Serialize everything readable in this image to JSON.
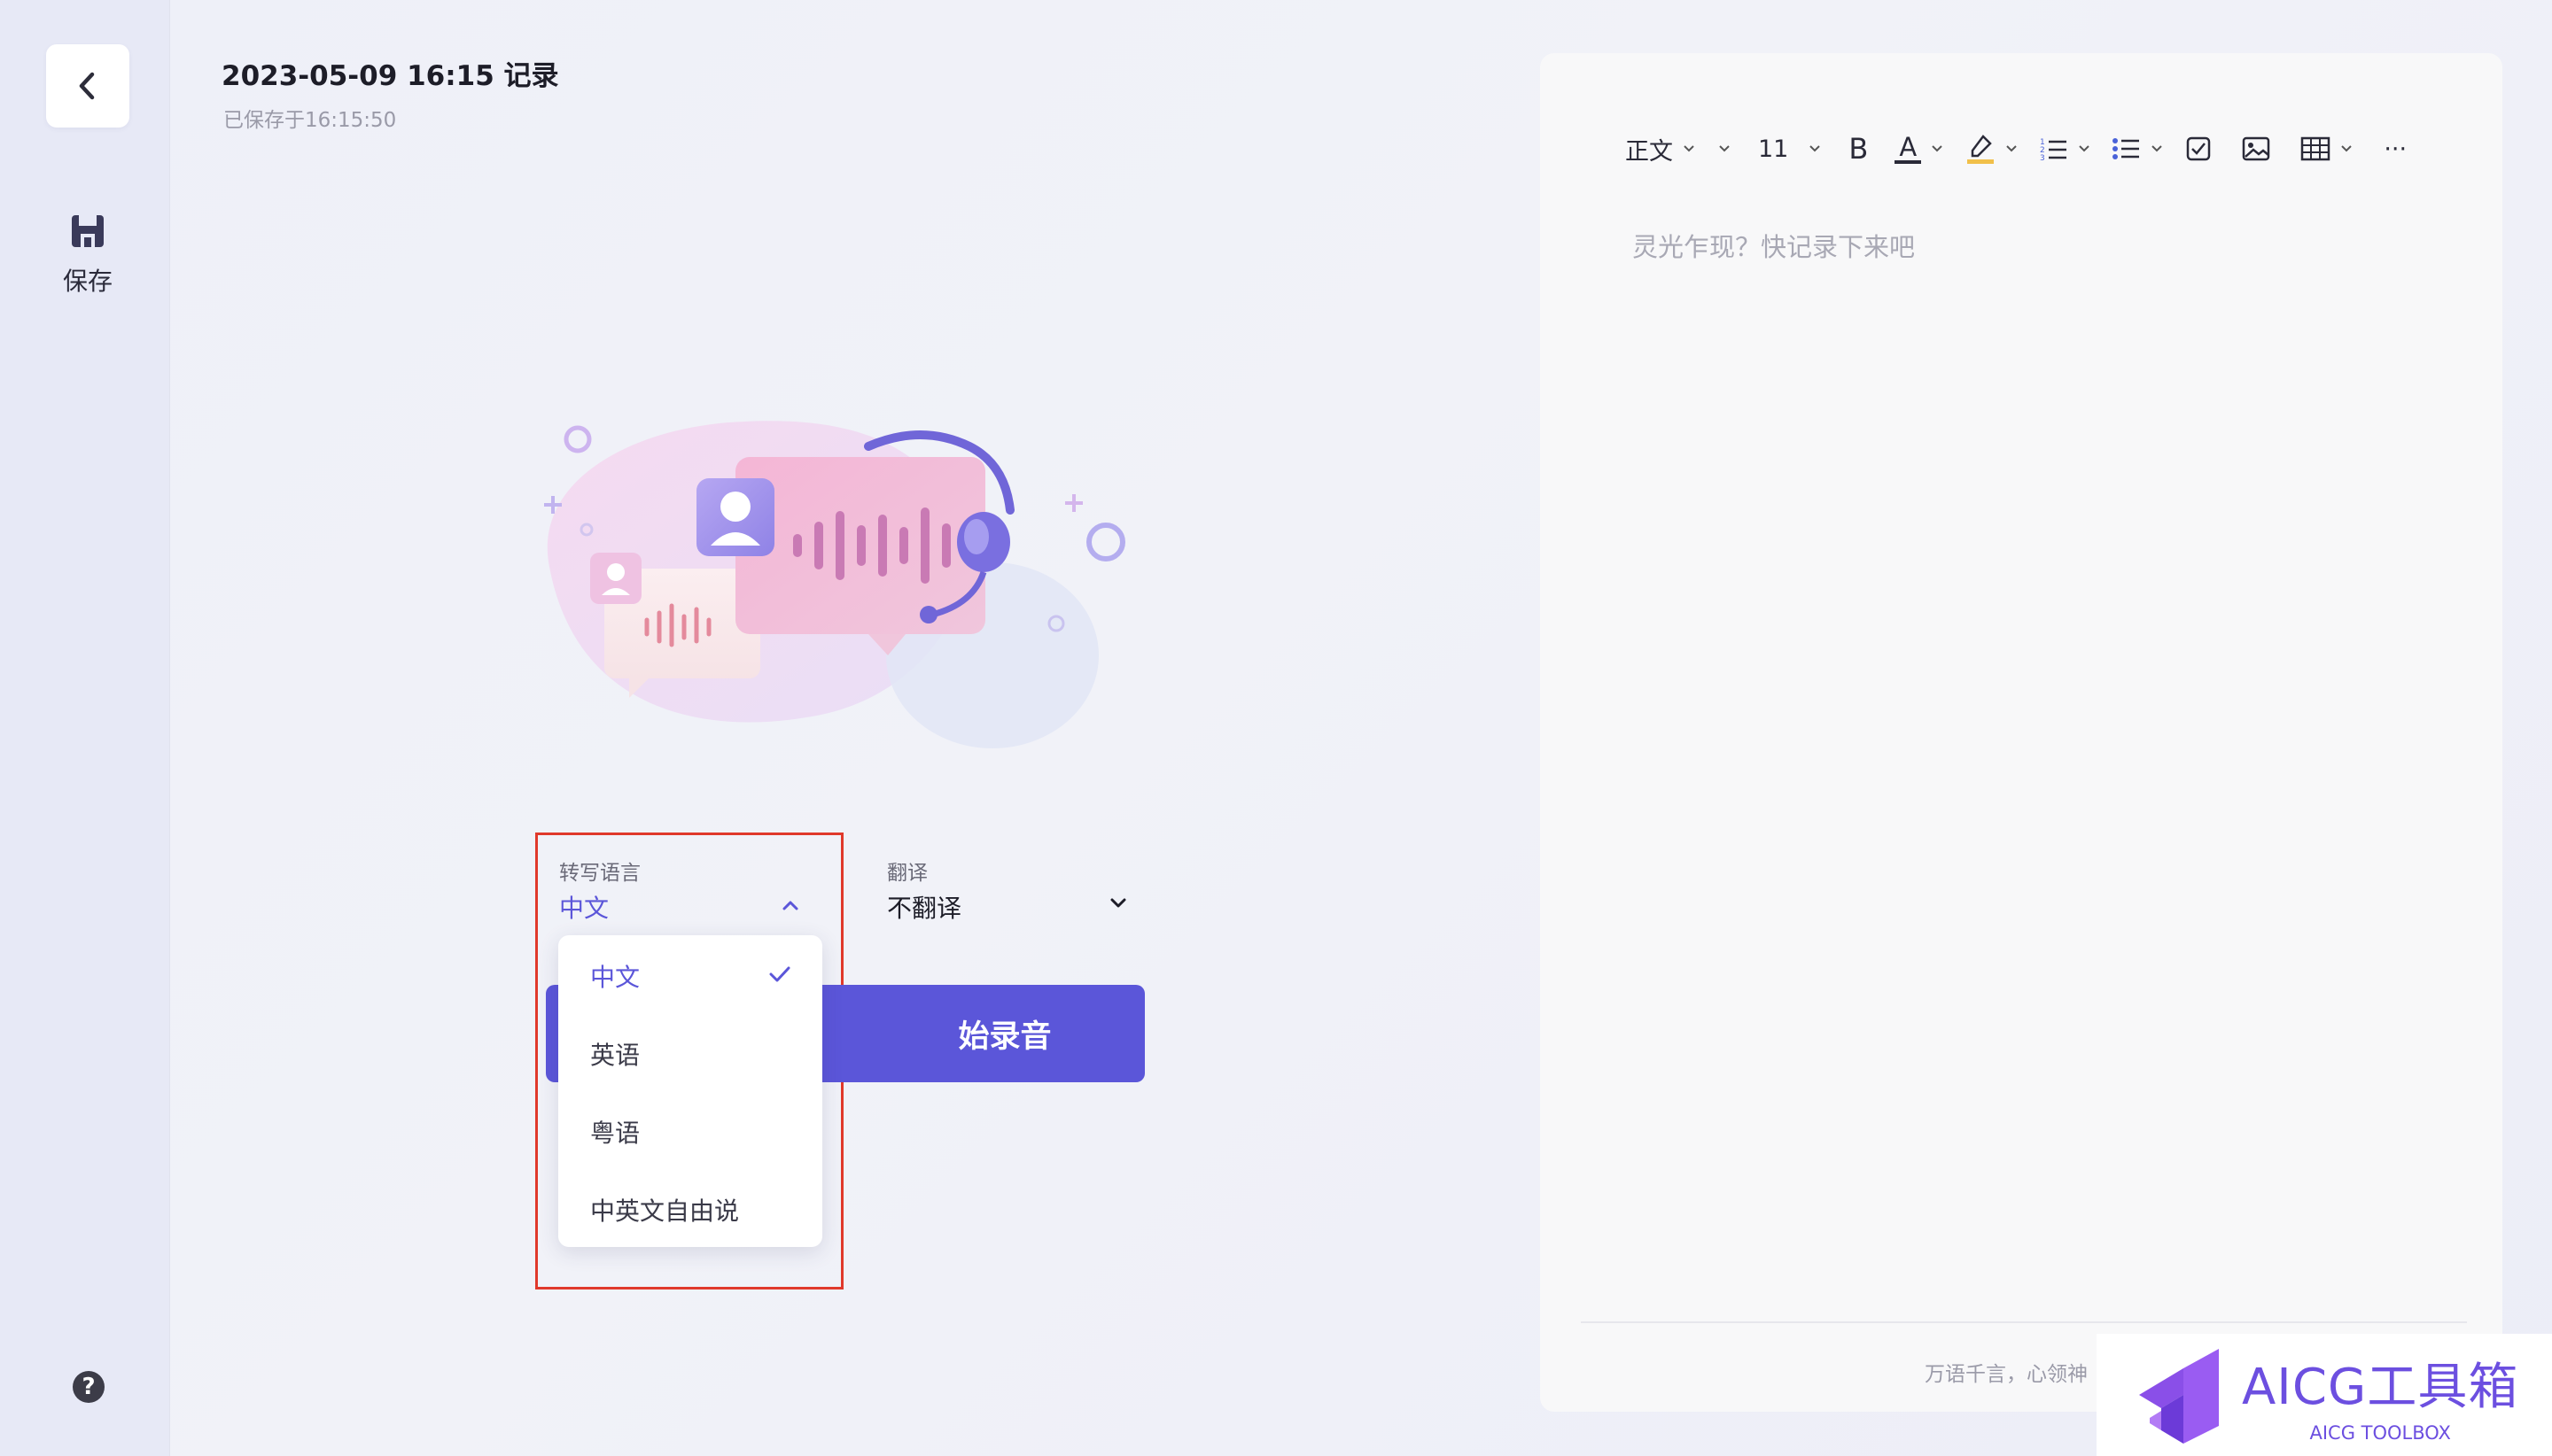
{
  "header": {
    "title": "2023-05-09 16:15 记录",
    "saved_status": "已保存于16:15:50"
  },
  "sidebar": {
    "save_label": "保存",
    "icons": [
      "back-arrow-icon",
      "save-disk-icon",
      "help-icon"
    ]
  },
  "transcribe": {
    "language_label": "转写语言",
    "language_value": "中文",
    "translate_label": "翻译",
    "translate_value": "不翻译",
    "record_button": "开始录音",
    "record_button_visible": "始录音"
  },
  "dropdown": {
    "options": [
      {
        "label": "中文",
        "selected": true
      },
      {
        "label": "英语",
        "selected": false
      },
      {
        "label": "粤语",
        "selected": false
      },
      {
        "label": "中英文自由说",
        "selected": false
      }
    ]
  },
  "editor": {
    "toolbar": {
      "style": "正文",
      "font_size": "11",
      "bold": "B",
      "font_color": "A",
      "more": "···"
    },
    "placeholder": "灵光乍现？快记录下来吧",
    "footer": "万语千言，心领神"
  },
  "watermark": {
    "title": "AICG工具箱",
    "subtitle": "AICG TOOLBOX"
  },
  "colors": {
    "accent": "#5b56d9",
    "highlight_box": "#e0392b",
    "background": "#eef0f8"
  }
}
